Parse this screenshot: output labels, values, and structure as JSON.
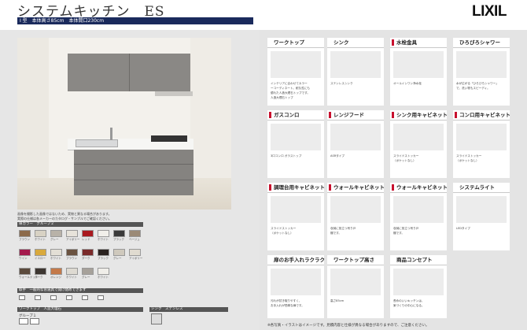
{
  "header": {
    "title": "システムキッチン　ES",
    "logo": "LIXIL",
    "subtitle": "I 型　本体高さ85cm　本体間口230cm"
  },
  "scene": {
    "note_line1": "画像を撮影した画像ではないため、実物と異なる場合があります。",
    "note_line2": "実際の仕様は各メーカーのカタログ・サンプルでご確認ください。"
  },
  "sections": {
    "door_color": "扉カラー　グループ２",
    "handle": "取手　一般的なお道具で開け閉めできます",
    "worktop": "ワークトップ　人造大理石",
    "worktop_group": "グループ１",
    "sink": "シンク　ステンレス"
  },
  "swatches": [
    {
      "color": "#8c6a4a",
      "label": "ブラウン"
    },
    {
      "color": "#d8d2c4",
      "label": "ホワイト"
    },
    {
      "color": "#b8b2a8",
      "label": "グレー"
    },
    {
      "color": "#e7e3da",
      "label": "アイボリー"
    },
    {
      "color": "#a9191f",
      "label": "レッド"
    },
    {
      "color": "#f1efea",
      "label": "ホワイト"
    },
    {
      "color": "#3a3a3a",
      "label": "ブラック"
    },
    {
      "color": "#9b8a76",
      "label": "ベージュ"
    },
    {
      "color": "#a41a4d",
      "label": "ワイン"
    },
    {
      "color": "#d9a93c",
      "label": "イエロー"
    },
    {
      "color": "#e3dfd6",
      "label": "ホワイト"
    },
    {
      "color": "#6a5240",
      "label": "ブラウン"
    },
    {
      "color": "#7a2a2a",
      "label": "ダーク"
    },
    {
      "color": "#2a2220",
      "label": "ブラック"
    },
    {
      "color": "#cfc9bd",
      "label": "グレー"
    },
    {
      "color": "#e0dbd0",
      "label": "アイボリー"
    },
    {
      "color": "#5b4a3c",
      "label": "ウォールナット"
    },
    {
      "color": "#3d3631",
      "label": "ダーク"
    },
    {
      "color": "#c47a4a",
      "label": "オレンジ"
    },
    {
      "color": "#dedad2",
      "label": "ホワイト"
    },
    {
      "color": "#a6a19a",
      "label": "グレー"
    },
    {
      "color": "#f0eee9",
      "label": "ホワイト"
    }
  ],
  "cards": [
    {
      "title": "ワークトップ",
      "accent": "#ffffff",
      "text1": "インテリアに合わせてカラー",
      "text2": "ーコーディネート。耐久性にも",
      "text3": "優れた人造大理石トップです。",
      "text4": "人造大理石トップ"
    },
    {
      "title": "シンク",
      "accent": "#ffffff",
      "text1": "ステンレスシンク",
      "text2": "",
      "text3": "",
      "text4": ""
    },
    {
      "title": "水栓金具",
      "accent": "#c8102e",
      "text1": "オールインワン浄水栓",
      "text2": "",
      "text3": "",
      "text4": ""
    },
    {
      "title": "ひろびろシャワー",
      "accent": "#ffffff",
      "text1": "水が広がる「ひろびろシャワー」",
      "text2": "で、洗い物もスピーディ。",
      "text3": "",
      "text4": ""
    },
    {
      "title": "ガスコンロ",
      "accent": "#c8102e",
      "text1": "3口コンロ ガラストップ",
      "text2": "",
      "text3": "",
      "text4": ""
    },
    {
      "title": "レンジフード",
      "accent": "#c8102e",
      "text1": "ASRタイプ",
      "text2": "",
      "text3": "",
      "text4": ""
    },
    {
      "title": "シンク用キャビネット",
      "accent": "#c8102e",
      "text1": "スライドストッカー",
      "text2": "（ポケットなし）",
      "text3": "",
      "text4": ""
    },
    {
      "title": "コンロ用キャビネット",
      "accent": "#c8102e",
      "text1": "スライドストッカー",
      "text2": "（ポケットなし）",
      "text3": "",
      "text4": ""
    },
    {
      "title": "調理台用キャビネット",
      "accent": "#c8102e",
      "text1": "スライドストッカー",
      "text2": "（ポケットなし）",
      "text3": "",
      "text4": ""
    },
    {
      "title": "ウォールキャビネット",
      "accent": "#c8102e",
      "text1": "収納に役立つ吊り戸",
      "text2": "棚です。",
      "text3": "",
      "text4": ""
    },
    {
      "title": "ウォールキャビネット",
      "accent": "#c8102e",
      "text1": "収納に役立つ吊り戸",
      "text2": "棚です。",
      "text3": "",
      "text4": ""
    },
    {
      "title": "システムライト",
      "accent": "#ffffff",
      "text1": "LEDタイプ",
      "text2": "",
      "text3": "",
      "text4": ""
    },
    {
      "title": "扉のお手入れラクラク",
      "accent": "#ffffff",
      "text1": "汚れが拭き取りやすく、",
      "text2": "お手入れが簡単な扉です。",
      "text3": "",
      "text4": ""
    },
    {
      "title": "ワークトップ高さ",
      "accent": "#ffffff",
      "text1": "高さ85cm",
      "text2": "",
      "text3": "",
      "text4": ""
    },
    {
      "title": "商品コンセプト",
      "accent": "#ffffff",
      "text1": "長めのいいキッチンは、",
      "text2": "家づくりの中心になる。",
      "text3": "",
      "text4": ""
    }
  ],
  "footnote": "※各写真・イラストはイメージです。見積内容と仕様が異なる場合がありますので、ご注意ください。"
}
